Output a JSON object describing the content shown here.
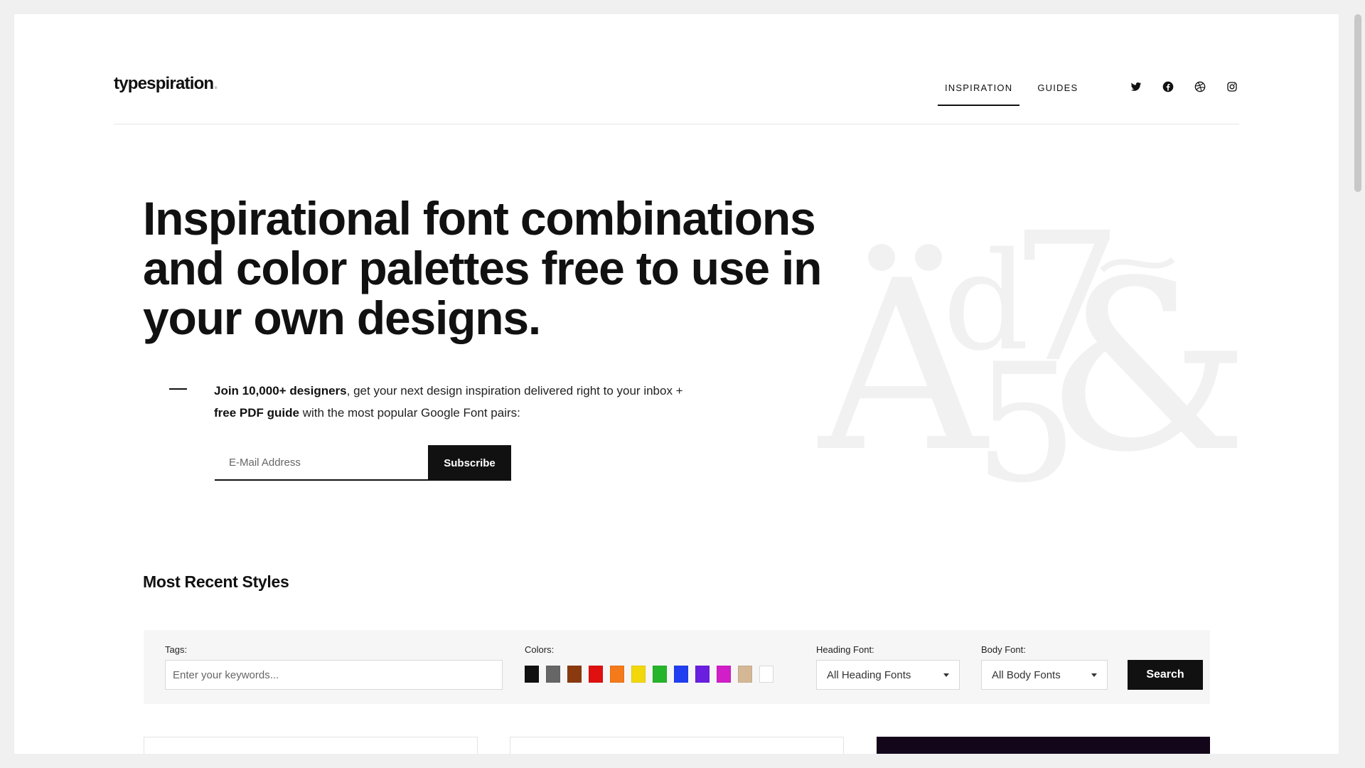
{
  "header": {
    "logo_text": "typespiration",
    "logo_dot": ".",
    "nav": [
      {
        "label": "INSPIRATION",
        "active": true
      },
      {
        "label": "GUIDES",
        "active": false
      }
    ],
    "social_icons": [
      "twitter-icon",
      "facebook-icon",
      "dribbble-icon",
      "instagram-icon"
    ]
  },
  "hero": {
    "title": "Inspirational font combinations and color palettes free to use in your own designs.",
    "intro_bold1": "Join 10,000+ designers",
    "intro_text1": ", get your next design inspiration delivered right to your inbox + ",
    "intro_bold2": "free PDF guide",
    "intro_text2": " with the most popular Google Font pairs:",
    "email_placeholder": "E-Mail Address",
    "subscribe_label": "Subscribe",
    "art_glyphs": {
      "a": "A",
      "d": "d",
      "seven": "7",
      "five": "5",
      "amp": "&"
    }
  },
  "section": {
    "title": "Most Recent Styles"
  },
  "filters": {
    "tags_label": "Tags:",
    "tags_placeholder": "Enter your keywords...",
    "colors_label": "Colors:",
    "colors": [
      "#111111",
      "#666666",
      "#8b3a0f",
      "#e01010",
      "#f57a1a",
      "#f2d80a",
      "#25b52a",
      "#1f3ff0",
      "#6a1ee0",
      "#d11ec8",
      "#d4b896",
      "#ffffff"
    ],
    "heading_label": "Heading Font:",
    "heading_value": "All Heading Fonts",
    "body_label": "Body Font:",
    "body_value": "All Body Fonts",
    "search_label": "Search"
  }
}
